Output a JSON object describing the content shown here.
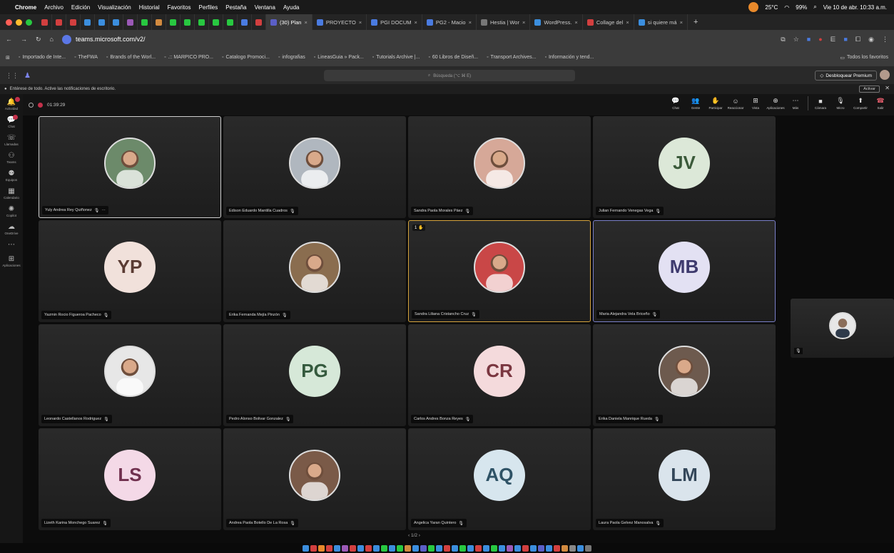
{
  "menubar": {
    "apple": "",
    "app": "Chrome",
    "items": [
      "Archivo",
      "Edición",
      "Visualización",
      "Historial",
      "Favoritos",
      "Perfiles",
      "Pestaña",
      "Ventana",
      "Ayuda"
    ],
    "temp": "25°C",
    "battery": "99%",
    "datetime": "Vie 10 de abr. 10:33 a.m."
  },
  "tabs": {
    "pinned_count": 16,
    "items": [
      {
        "label": "(30) Plan",
        "color": "#5b5fc7",
        "active": true
      },
      {
        "label": "PROYECTO",
        "color": "#4a7be0"
      },
      {
        "label": "PGI DOCUM",
        "color": "#4a7be0"
      },
      {
        "label": "PG2 - Macio",
        "color": "#4a7be0"
      },
      {
        "label": "Hestia | Wor",
        "color": "#777"
      },
      {
        "label": "WordPress.",
        "color": "#3b8ede"
      },
      {
        "label": "Collage del",
        "color": "#d23f3f"
      },
      {
        "label": "si quiere má",
        "color": "#3b8ede"
      }
    ],
    "plus": "+"
  },
  "address": {
    "url": "teams.microsoft.com/v2/"
  },
  "bookmarks": {
    "items": [
      "Importado de Inte...",
      "TheFWA",
      "Brands of the Worl...",
      ".:: MARPICO PRO...",
      "Catalogo Promoci...",
      "infografias",
      "LineasGuia » Pack...",
      "Tutorials Archive |...",
      "60 Libros de Diseñ...",
      "Transport Archives...",
      "Información y tend..."
    ],
    "all": "Todos los favoritos"
  },
  "teams_header": {
    "search": "Búsqueda (⌥ ⌘ E)",
    "premium": "Desbloquear Premium"
  },
  "notification": {
    "text": "Entérese de todo. Active las notificaciones de escritorio.",
    "button": "Activar",
    "close": "✕"
  },
  "rail": [
    {
      "label": "Actividad",
      "icon": "bell-icon",
      "glyph": "🔔",
      "badge": true
    },
    {
      "label": "Chat",
      "icon": "chat-icon",
      "glyph": "💬",
      "badge": true
    },
    {
      "label": "Llamadas",
      "icon": "phone-icon",
      "glyph": "☏"
    },
    {
      "label": "Teams",
      "icon": "teams-icon",
      "glyph": "⚇"
    },
    {
      "label": "Equipos",
      "icon": "group-icon",
      "glyph": "⚉"
    },
    {
      "label": "Calendario",
      "icon": "calendar-icon",
      "glyph": "▦"
    },
    {
      "label": "Copilot",
      "icon": "copilot-icon",
      "glyph": "✺"
    },
    {
      "label": "OneDrive",
      "icon": "cloud-icon",
      "glyph": "☁"
    },
    {
      "label": "",
      "icon": "more-icon",
      "glyph": "⋯"
    },
    {
      "label": "Aplicaciones",
      "icon": "apps-icon",
      "glyph": "⊞"
    }
  ],
  "meeting": {
    "timer": "01:39:29",
    "tools": [
      {
        "label": "Chat",
        "glyph": "💬"
      },
      {
        "label": "Gente",
        "glyph": "👥"
      },
      {
        "label": "Participar",
        "glyph": "✋"
      },
      {
        "label": "Reaccionar",
        "glyph": "☺"
      },
      {
        "label": "Vista",
        "glyph": "⊞"
      },
      {
        "label": "Aplicaciones",
        "glyph": "⊕"
      },
      {
        "label": "Más",
        "glyph": "⋯"
      },
      {
        "label": "Cámara",
        "glyph": "■"
      },
      {
        "label": "Micro",
        "glyph": "🎙"
      },
      {
        "label": "Compartir",
        "glyph": "⬆"
      },
      {
        "label": "Salir",
        "glyph": "☎"
      }
    ]
  },
  "participants": [
    {
      "name": "Yuly Andrea Rey Quiñonez",
      "type": "photo",
      "color": "#6c8a6a",
      "state": "sel",
      "more": "···"
    },
    {
      "name": "Edison Eduardo Mantilla Cuadros",
      "type": "photo",
      "color": "#b0b7bf"
    },
    {
      "name": "Sandra Paola Morales Páez",
      "type": "photo",
      "color": "#d6a898"
    },
    {
      "name": "Julian Fernando Venegas Vega",
      "initials": "JV",
      "bg": "#dce8d8",
      "fg": "#3b5a3a"
    },
    {
      "name": "Yazmin Rocio Figueroa Pacheco",
      "initials": "YP",
      "bg": "#f1e1db",
      "fg": "#5a3b33"
    },
    {
      "name": "Erika Fernanda Mejía Pinzón",
      "type": "photo",
      "color": "#8a6d4f"
    },
    {
      "name": "Sandra Liliana Cristancho Cruz",
      "type": "photo",
      "color": "#c94747",
      "state": "speaking",
      "hand": "1 ✋"
    },
    {
      "name": "Maria Alejandra Vela Briceño",
      "initials": "MB",
      "bg": "#e3e1f3",
      "fg": "#3e3a6e",
      "state": "pinned"
    },
    {
      "name": "Leonardo Castellanos Rodriguez",
      "type": "photo",
      "color": "#e7e7e7"
    },
    {
      "name": "Pedro Alonso Bolivar Gonzalez",
      "initials": "PG",
      "bg": "#d6e8d8",
      "fg": "#355a3e"
    },
    {
      "name": "Carlos Andres Bonza Reyes",
      "initials": "CR",
      "bg": "#f4dadc",
      "fg": "#7a3640"
    },
    {
      "name": "Erika Daniela Manrique Rueda",
      "type": "photo",
      "color": "#6d5a4e"
    },
    {
      "name": "Lizeth Karina Monchego Suarez",
      "initials": "LS",
      "bg": "#f4d9e7",
      "fg": "#70304e"
    },
    {
      "name": "Andrea Paola Botello De La Rosa",
      "type": "photo",
      "color": "#7a5a48"
    },
    {
      "name": "Angelica Yaran Quintero",
      "initials": "AQ",
      "bg": "#d7e6ee",
      "fg": "#2f5366"
    },
    {
      "name": "Laura Paola Gelvez Manosalva",
      "initials": "LM",
      "bg": "#dae4ec",
      "fg": "#34475a"
    }
  ],
  "pager": "‹ 1/2 ›",
  "colors": {
    "speaking": "#d6a43d",
    "pinned": "#7a7fc9",
    "record": "#c4314b"
  }
}
